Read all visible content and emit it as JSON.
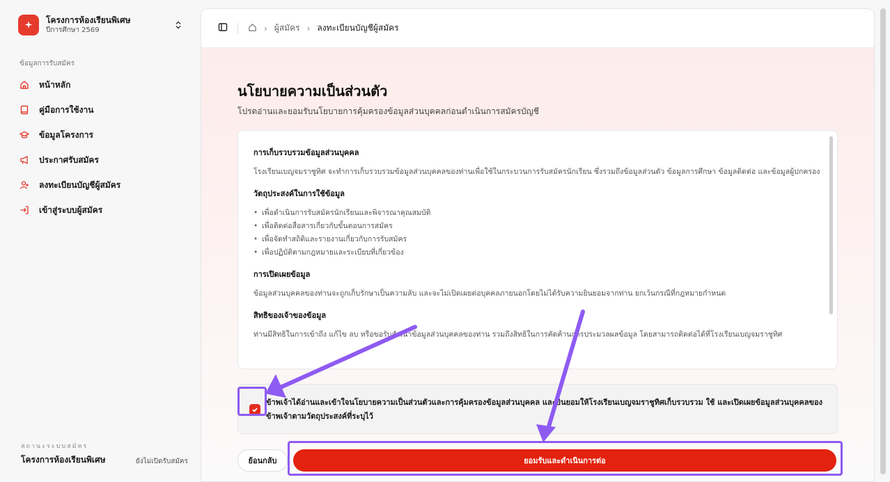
{
  "brand": {
    "title": "โครงการห้องเรียนพิเศษ",
    "subtitle": "ปีการศึกษา 2569",
    "logo_color": "#e53b2c"
  },
  "sidebar": {
    "section_label": "ข้อมูลการรับสมัคร",
    "items": [
      {
        "label": "หน้าหลัก",
        "icon": "home-icon"
      },
      {
        "label": "คู่มือการใช้งาน",
        "icon": "book-icon"
      },
      {
        "label": "ข้อมูลโครงการ",
        "icon": "graduation-cap-icon"
      },
      {
        "label": "ประกาศรับสมัคร",
        "icon": "megaphone-icon"
      },
      {
        "label": "ลงทะเบียนบัญชีผู้สมัคร",
        "icon": "user-plus-icon"
      },
      {
        "label": "เข้าสู่ระบบผู้สมัคร",
        "icon": "login-icon"
      }
    ],
    "status_caption": "สถานะระบบสมัคร",
    "status_name": "โครงการห้องเรียนพิเศษ",
    "status_badge": "ยังไม่เปิดรับสมัคร"
  },
  "topbar": {
    "breadcrumb": [
      "ผู้สมัคร",
      "ลงทะเบียนบัญชีผู้สมัคร"
    ]
  },
  "page": {
    "title": "นโยบายความเป็นส่วนตัว",
    "subtitle": "โปรดอ่านและยอมรับนโยบายการคุ้มครองข้อมูลส่วนบุคคลก่อนดำเนินการสมัครบัญชี"
  },
  "policy": {
    "s1_heading": "การเก็บรวบรวมข้อมูลส่วนบุคคล",
    "s1_body": "โรงเรียนเบญจมราชูทิศ จะทำการเก็บรวบรวมข้อมูลส่วนบุคคลของท่านเพื่อใช้ในกระบวนการรับสมัครนักเรียน ซึ่งรวมถึงข้อมูลส่วนตัว ข้อมูลการศึกษา ข้อมูลติดต่อ และข้อมูลผู้ปกครอง",
    "s2_heading": "วัตถุประสงค์ในการใช้ข้อมูล",
    "s2_items": [
      "เพื่อดำเนินการรับสมัครนักเรียนและพิจารณาคุณสมบัติ",
      "เพื่อติดต่อสื่อสารเกี่ยวกับขั้นตอนการสมัคร",
      "เพื่อจัดทำสถิติและรายงานเกี่ยวกับการรับสมัคร",
      "เพื่อปฏิบัติตามกฎหมายและระเบียบที่เกี่ยวข้อง"
    ],
    "s3_heading": "การเปิดเผยข้อมูล",
    "s3_body": "ข้อมูลส่วนบุคคลของท่านจะถูกเก็บรักษาเป็นความลับ และจะไม่เปิดเผยต่อบุคคลภายนอกโดยไม่ได้รับความยินยอมจากท่าน ยกเว้นกรณีที่กฎหมายกำหนด",
    "s4_heading": "สิทธิของเจ้าของข้อมูล",
    "s4_body": "ท่านมีสิทธิในการเข้าถึง แก้ไข ลบ หรือขอรับสำเนาข้อมูลส่วนบุคคลของท่าน รวมถึงสิทธิในการคัดค้านการประมวลผลข้อมูล โดยสามารถติดต่อได้ที่โรงเรียนเบญจมราชูทิศ"
  },
  "consent": {
    "checked": true,
    "text": "ข้าพเจ้าได้อ่านและเข้าใจนโยบายความเป็นส่วนตัวและการคุ้มครองข้อมูลส่วนบุคคล และยินยอมให้โรงเรียนเบญจมราชูทิศเก็บรวบรวม ใช้ และเปิดเผยข้อมูลส่วนบุคคลของข้าพเจ้าตามวัตถุประสงค์ที่ระบุไว้"
  },
  "actions": {
    "back_label": "ย้อนกลับ",
    "accept_label": "ยอมรับและดำเนินการต่อ"
  },
  "colors": {
    "accent": "#e3220f",
    "annotation": "#8e5bf2"
  }
}
